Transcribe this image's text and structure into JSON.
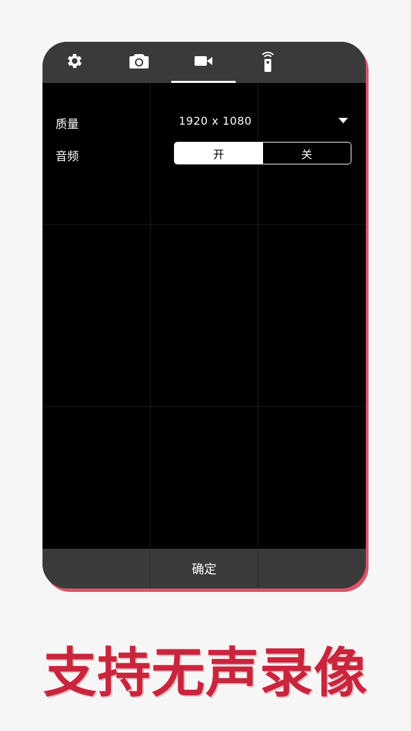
{
  "tabs": [
    {
      "icon": "gear-icon"
    },
    {
      "icon": "camera-icon"
    },
    {
      "icon": "video-camera-icon",
      "active": true
    },
    {
      "icon": "remote-icon"
    }
  ],
  "settings": {
    "quality_label": "质量",
    "quality_value": "1920  x 1080",
    "audio_label": "音频",
    "audio_on": "开",
    "audio_off": "关",
    "audio_selected": "开"
  },
  "bottom": {
    "confirm_label": "确定"
  },
  "caption": "支持无声录像",
  "colors": {
    "accent": "#c9253d",
    "bar": "#3a3a3a",
    "frame_shadow": "#d9566a"
  }
}
